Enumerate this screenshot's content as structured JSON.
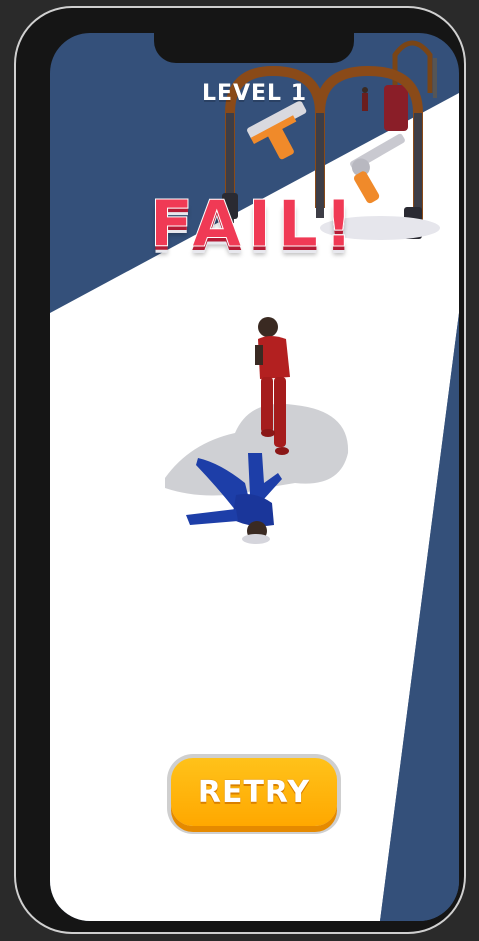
{
  "hud": {
    "level_label": "LEVEL 1"
  },
  "result": {
    "title": "FAIL!"
  },
  "actions": {
    "retry_label": "RETRY"
  },
  "colors": {
    "background": "#34507a",
    "track": "#ffffff",
    "fail_text": "#f03a55",
    "retry_button": "#ffb20d",
    "enemy": "#b32020",
    "player": "#1d3ea8",
    "gate_arch": "#8a4a18"
  },
  "scene": {
    "icons": [
      "pistol-icon",
      "revolver-icon",
      "gate-arch-icon",
      "enemy-character-icon",
      "player-character-icon"
    ]
  }
}
